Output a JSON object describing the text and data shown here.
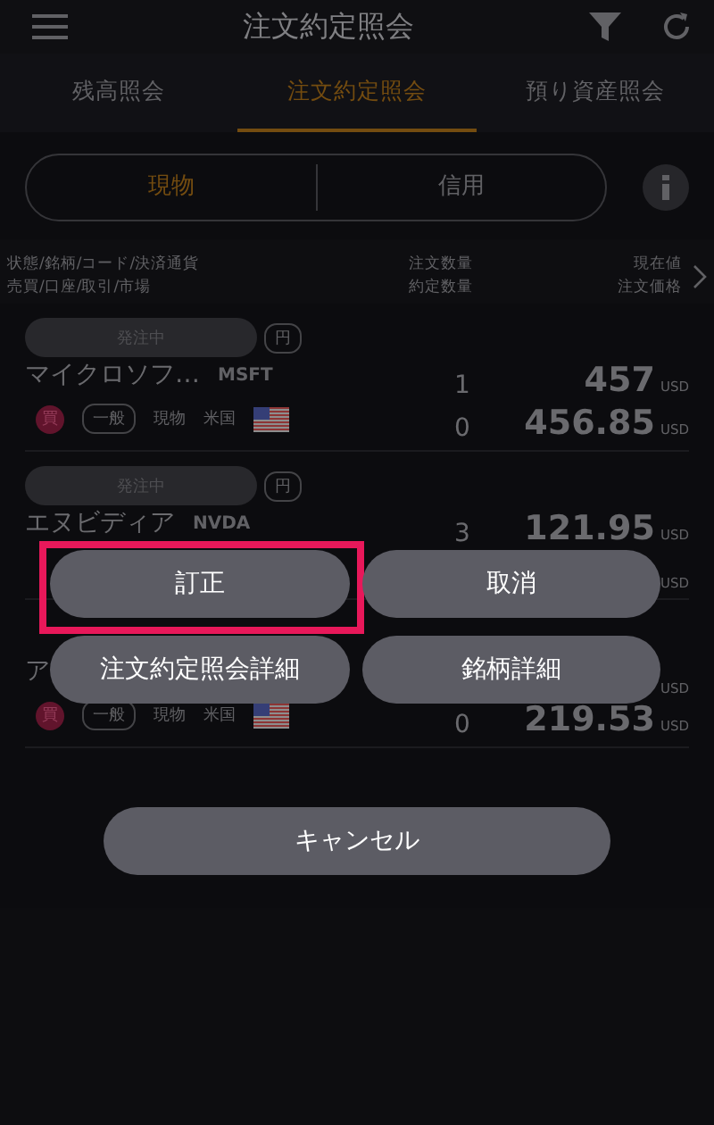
{
  "header": {
    "title": "注文約定照会"
  },
  "tabs": [
    {
      "label": "残高照会",
      "selected": false
    },
    {
      "label": "注文約定照会",
      "selected": true
    },
    {
      "label": "預り資産照会",
      "selected": false
    }
  ],
  "segments": [
    {
      "label": "現物",
      "selected": true
    },
    {
      "label": "信用",
      "selected": false
    }
  ],
  "columns": {
    "left": [
      "状態/銘柄/コード/決済通貨",
      "売買/口座/取引/市場"
    ],
    "middle": [
      "注文数量",
      "約定数量"
    ],
    "right": [
      "現在値",
      "注文価格"
    ]
  },
  "orders": [
    {
      "status": "発注中",
      "currency_chip": "円",
      "name": "マイクロソフ…",
      "code": "MSFT",
      "order_qty": "1",
      "current_price": "457",
      "current_unit": "USD",
      "side": "買",
      "account": "一般",
      "trade": "現物",
      "market": "米国",
      "filled_qty": "0",
      "order_price": "456.85",
      "order_unit": "USD"
    },
    {
      "status": "発注中",
      "currency_chip": "円",
      "name": "エヌビディア",
      "code": "NVDA",
      "order_qty": "3",
      "current_price": "121.95",
      "current_unit": "USD",
      "order_unit": "USD"
    },
    {
      "name": "ア",
      "current_unit": "USD",
      "side": "買",
      "account": "一般",
      "trade": "現物",
      "market": "米国",
      "filled_qty": "0",
      "order_price": "219.53",
      "order_unit": "USD"
    }
  ],
  "actions": [
    {
      "label": "訂正",
      "highlighted": true
    },
    {
      "label": "取消",
      "highlighted": false
    },
    {
      "label": "注文約定照会詳細",
      "highlighted": false
    },
    {
      "label": "銘柄詳細",
      "highlighted": false
    }
  ],
  "cancel_button": {
    "label": "キャンセル"
  }
}
